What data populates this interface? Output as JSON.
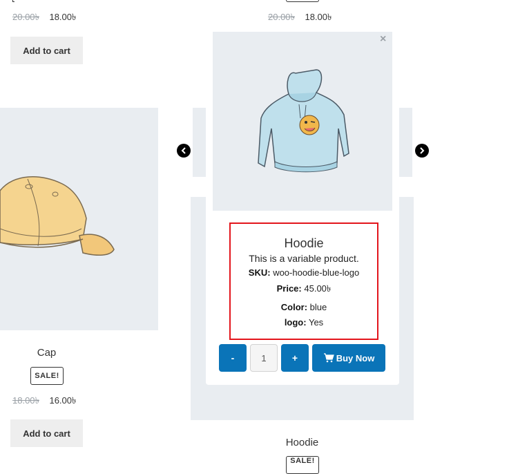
{
  "top_left": {
    "price_old": "20.00৳",
    "price_new": "18.00৳",
    "cart_label": "Add to cart"
  },
  "top_mid": {
    "price_old": "20.00৳",
    "price_new": "18.00৳"
  },
  "cap_card": {
    "title": "Cap",
    "badge": "SALE!",
    "price_old": "18.00৳",
    "price_new": "16.00৳",
    "cart_label": "Add to cart"
  },
  "bottom_mid": {
    "title": "Hoodie",
    "badge": "SALE!"
  },
  "popup": {
    "close_glyph": "×",
    "title": "Hoodie",
    "description": "This is a variable product.",
    "sku_label": "SKU:",
    "sku_value": "woo-hoodie-blue-logo",
    "price_label": "Price:",
    "price_value": "45.00৳",
    "color_label": "Color:",
    "color_value": "blue",
    "logo_label": "logo:",
    "logo_value": "Yes",
    "qty_minus": "-",
    "qty_value": "1",
    "qty_plus": "+",
    "buy_label": "Buy Now",
    "highlight_color": "#e3141b",
    "button_color": "#0a74b8"
  },
  "nav": {
    "prev_icon": "arrow-left-icon",
    "next_icon": "arrow-right-icon"
  },
  "colors": {
    "card_bg": "#e9edf1",
    "cart_bg": "#eeeeee"
  }
}
